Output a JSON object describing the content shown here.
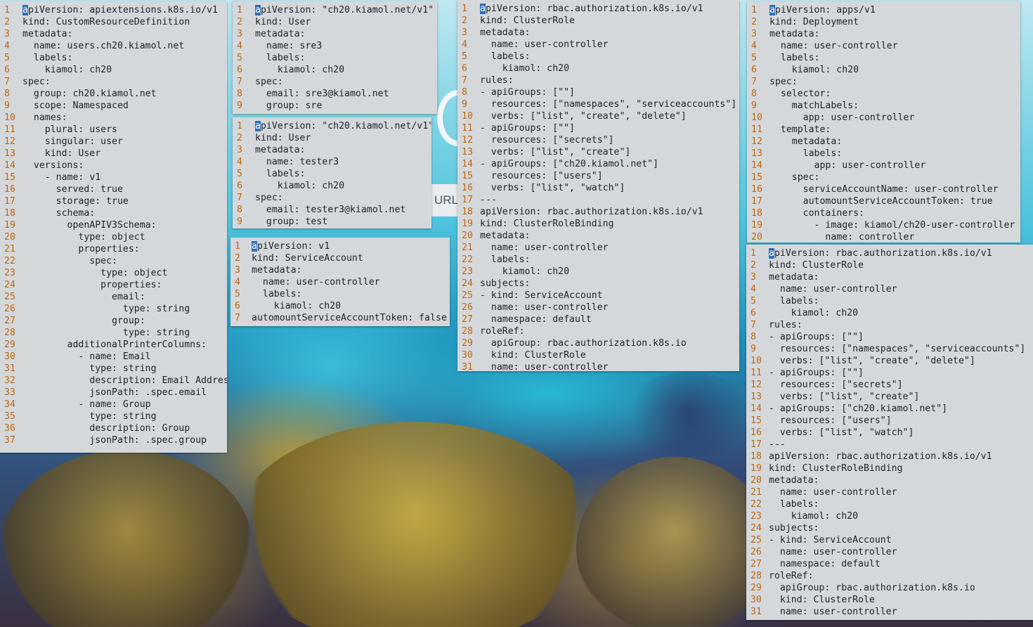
{
  "desktop": {
    "background": "underwater coral reef wallpaper",
    "partial_label": "URL"
  },
  "windows": [
    {
      "id": "crd",
      "lines": [
        "apiVersion: apiextensions.k8s.io/v1",
        "kind: CustomResourceDefinition",
        "metadata:",
        "  name: users.ch20.kiamol.net",
        "  labels:",
        "    kiamol: ch20",
        "spec:",
        "  group: ch20.kiamol.net",
        "  scope: Namespaced",
        "  names:",
        "    plural: users",
        "    singular: user",
        "    kind: User",
        "  versions:",
        "    - name: v1",
        "      served: true",
        "      storage: true",
        "      schema:",
        "        openAPIV3Schema:",
        "          type: object",
        "          properties:",
        "            spec:",
        "              type: object",
        "              properties:",
        "                email:",
        "                  type: string",
        "                group:",
        "                  type: string",
        "        additionalPrinterColumns:",
        "          - name: Email",
        "            type: string",
        "            description: Email Address",
        "            jsonPath: .spec.email",
        "          - name: Group",
        "            type: string",
        "            description: Group",
        "            jsonPath: .spec.group"
      ]
    },
    {
      "id": "user-sre3",
      "lines": [
        "apiVersion: \"ch20.kiamol.net/v1\"",
        "kind: User",
        "metadata:",
        "  name: sre3",
        "  labels:",
        "    kiamol: ch20",
        "spec:",
        "  email: sre3@kiamol.net",
        "  group: sre"
      ]
    },
    {
      "id": "user-tester3",
      "lines": [
        "apiVersion: \"ch20.kiamol.net/v1\"",
        "kind: User",
        "metadata:",
        "  name: tester3",
        "  labels:",
        "    kiamol: ch20",
        "spec:",
        "  email: tester3@kiamol.net",
        "  group: test"
      ]
    },
    {
      "id": "serviceaccount",
      "lines": [
        "apiVersion: v1",
        "kind: ServiceAccount",
        "metadata:",
        "  name: user-controller",
        "  labels:",
        "    kiamol: ch20",
        "automountServiceAccountToken: false"
      ]
    },
    {
      "id": "rbac-middle",
      "lines": [
        "apiVersion: rbac.authorization.k8s.io/v1",
        "kind: ClusterRole",
        "metadata:",
        "  name: user-controller",
        "  labels:",
        "    kiamol: ch20",
        "rules:",
        "- apiGroups: [\"\"]",
        "  resources: [\"namespaces\", \"serviceaccounts\"]",
        "  verbs: [\"list\", \"create\", \"delete\"]",
        "- apiGroups: [\"\"]",
        "  resources: [\"secrets\"]",
        "  verbs: [\"list\", \"create\"]",
        "- apiGroups: [\"ch20.kiamol.net\"]",
        "  resources: [\"users\"]",
        "  verbs: [\"list\", \"watch\"]",
        "---",
        "apiVersion: rbac.authorization.k8s.io/v1",
        "kind: ClusterRoleBinding",
        "metadata:",
        "  name: user-controller",
        "  labels:",
        "    kiamol: ch20",
        "subjects:",
        "- kind: ServiceAccount",
        "  name: user-controller",
        "  namespace: default",
        "roleRef:",
        "  apiGroup: rbac.authorization.k8s.io",
        "  kind: ClusterRole",
        "  name: user-controller"
      ]
    },
    {
      "id": "deployment",
      "lines": [
        "apiVersion: apps/v1",
        "kind: Deployment",
        "metadata:",
        "  name: user-controller",
        "  labels:",
        "    kiamol: ch20",
        "spec:",
        "  selector:",
        "    matchLabels:",
        "      app: user-controller",
        "  template:",
        "    metadata:",
        "      labels:",
        "        app: user-controller",
        "    spec:",
        "      serviceAccountName: user-controller",
        "      automountServiceAccountToken: true",
        "      containers:",
        "        - image: kiamol/ch20-user-controller",
        "          name: controller"
      ]
    },
    {
      "id": "rbac-right",
      "lines": [
        "apiVersion: rbac.authorization.k8s.io/v1",
        "kind: ClusterRole",
        "metadata:",
        "  name: user-controller",
        "  labels:",
        "    kiamol: ch20",
        "rules:",
        "- apiGroups: [\"\"]",
        "  resources: [\"namespaces\", \"serviceaccounts\"]",
        "  verbs: [\"list\", \"create\", \"delete\"]",
        "- apiGroups: [\"\"]",
        "  resources: [\"secrets\"]",
        "  verbs: [\"list\", \"create\"]",
        "- apiGroups: [\"ch20.kiamol.net\"]",
        "  resources: [\"users\"]",
        "  verbs: [\"list\", \"watch\"]",
        "---",
        "apiVersion: rbac.authorization.k8s.io/v1",
        "kind: ClusterRoleBinding",
        "metadata:",
        "  name: user-controller",
        "  labels:",
        "    kiamol: ch20",
        "subjects:",
        "- kind: ServiceAccount",
        "  name: user-controller",
        "  namespace: default",
        "roleRef:",
        "  apiGroup: rbac.authorization.k8s.io",
        "  kind: ClusterRole",
        "  name: user-controller"
      ]
    }
  ]
}
